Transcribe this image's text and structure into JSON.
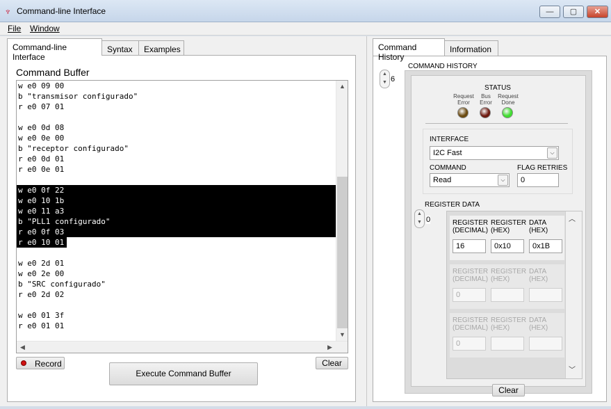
{
  "window": {
    "title": "Command-line Interface",
    "icon": "ti-logo-icon",
    "min": "—",
    "max": "▢",
    "close": "✕"
  },
  "menu": {
    "file": "File",
    "window": "Window"
  },
  "left_tabs": [
    "Command-line Interface",
    "Syntax",
    "Examples"
  ],
  "right_tabs": [
    "Command History",
    "Information"
  ],
  "buffer": {
    "title": "Command Buffer",
    "lines": [
      "w e0 09 00",
      "b \"transmisor configurado\"",
      "r e0 07 01",
      "",
      "w e0 0d 08",
      "w e0 0e 00",
      "b \"receptor configurado\"",
      "r e0 0d 01",
      "r e0 0e 01",
      "",
      "w e0 0f 22",
      "w e0 10 1b",
      "w e0 11 a3",
      "b \"PLL1 configurado\"",
      "r e0 0f 03",
      "r e0 10 01",
      "",
      "w e0 2d 01",
      "w e0 2e 00",
      "b \"SRC configurado\"",
      "r e0 2d 02",
      "",
      "w e0 01 3f",
      "r e0 01 01"
    ],
    "selected_from": 10,
    "selected_to": 15
  },
  "buttons": {
    "record": "Record",
    "clear_left": "Clear",
    "execute": "Execute Command Buffer",
    "clear_right": "Clear"
  },
  "history": {
    "title": "COMMAND HISTORY",
    "index": "6",
    "status": {
      "title": "STATUS",
      "leds": [
        {
          "label1": "Request",
          "label2": "Error",
          "color": "#6b4a10"
        },
        {
          "label1": "Bus",
          "label2": "Error",
          "color": "#6e1a10"
        },
        {
          "label1": "Request",
          "label2": "Done",
          "color": "#3fdc2f"
        }
      ]
    },
    "interface_label": "INTERFACE",
    "interface_value": "I2C Fast",
    "command_label": "COMMAND",
    "command_value": "Read",
    "flag_label": "FLAG RETRIES",
    "flag_value": "0",
    "register_title": "REGISTER DATA",
    "register_index": "0",
    "rows": [
      {
        "h1a": "REGISTER",
        "h1b": "(DECIMAL)",
        "h2a": "REGISTER",
        "h2b": "(HEX)",
        "h3a": "DATA",
        "h3b": "(HEX)",
        "dec": "16",
        "hex": "0x10",
        "data": "0x1B"
      },
      {
        "h1a": "REGISTER",
        "h1b": "(DECIMAL)",
        "h2a": "REGISTER",
        "h2b": "(HEX)",
        "h3a": "DATA",
        "h3b": "(HEX)",
        "dec": "0",
        "hex": "",
        "data": ""
      },
      {
        "h1a": "REGISTER",
        "h1b": "(DECIMAL)",
        "h2a": "REGISTER",
        "h2b": "(HEX)",
        "h3a": "DATA",
        "h3b": "(HEX)",
        "dec": "0",
        "hex": "",
        "data": ""
      }
    ]
  }
}
